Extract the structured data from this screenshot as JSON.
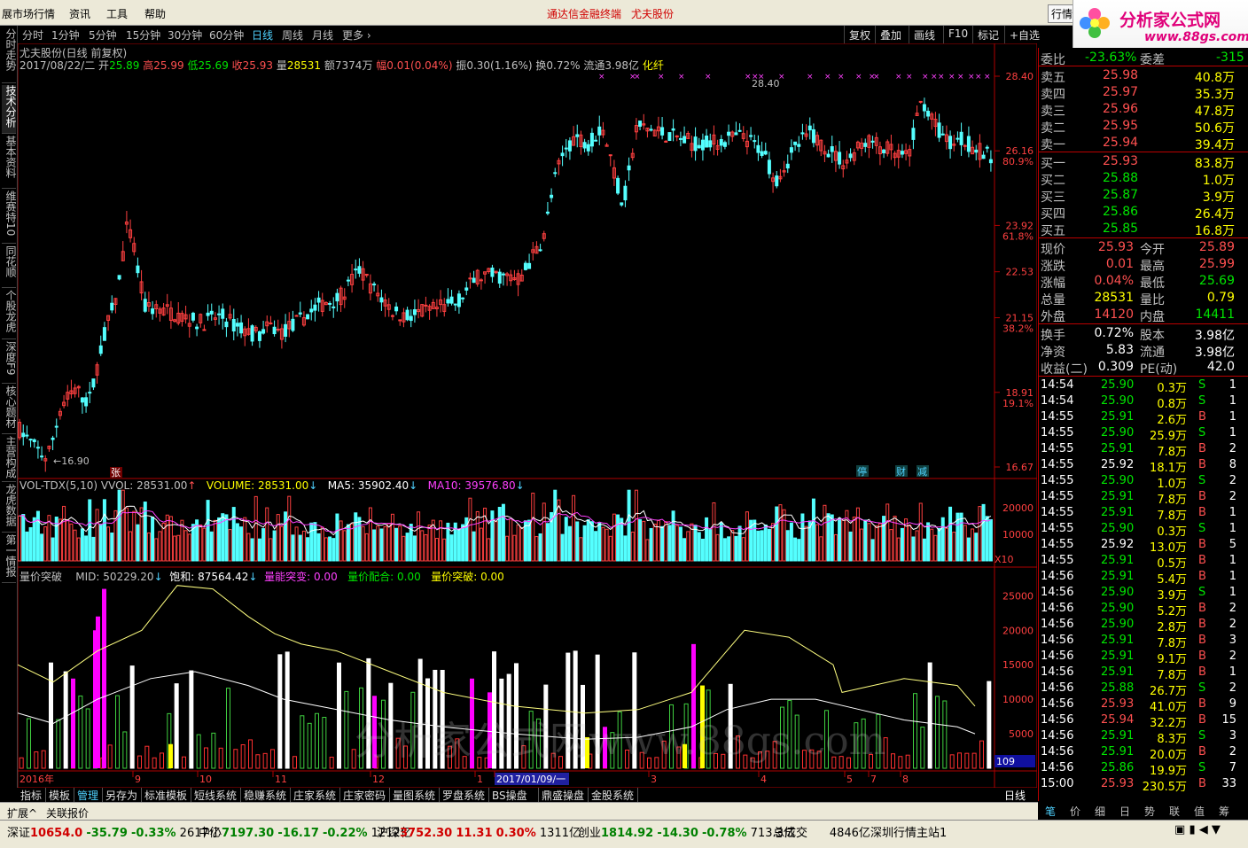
{
  "menu": {
    "market": "展市场行情",
    "news": "资讯",
    "tools": "工具",
    "help": "帮助",
    "center_promo": "通达信金融终端",
    "center_stock": "尤夫股份",
    "right_btn": "行情"
  },
  "logo": {
    "cn": "分析家公式网",
    "url": "www.88gs.com"
  },
  "periods": [
    "分时",
    "1分钟",
    "5分钟",
    "15分钟",
    "30分钟",
    "60分钟",
    "日线",
    "周线",
    "月线",
    "更多 ›"
  ],
  "active_period": "日线",
  "toolbar_right": [
    "复权",
    "叠加",
    "画线",
    "F10",
    "标记",
    "+自选"
  ],
  "left_tabs": [
    "分时走势",
    "技术分析",
    "基本资料",
    "维赛特10",
    "同花顺",
    "个股龙虎",
    "深度F9",
    "核心题材",
    "主营构成",
    "龙虎数据",
    "第一情报"
  ],
  "main": {
    "title": "尤夫股份(日线 前复权)",
    "date": "2017/08/22/二",
    "open_label": "开",
    "open": "25.89",
    "high_label": "高",
    "high": "25.99",
    "low_label": "低",
    "low": "25.69",
    "close_label": "收",
    "close": "25.93",
    "vol_label": "量",
    "vol": "28531",
    "amt_label": "额",
    "amt": "7374万",
    "chg_label": "幅",
    "chg": "0.01(0.04%)",
    "amp": "振0.30(1.16%)",
    "turn": "换0.72%",
    "flow": "流通3.98亿",
    "sector": "化纤",
    "hi_mark": "28.40",
    "lo_mark": "16.90",
    "y_labels": [
      "28.40",
      "26.16",
      "23.92",
      "22.53",
      "21.15",
      "18.91",
      "16.67"
    ],
    "pct_labels": [
      "80.9%",
      "61.8%",
      "38.2%",
      "19.1%"
    ],
    "zhang": "张",
    "events": [
      "停",
      "财",
      "减"
    ]
  },
  "vol_panel": {
    "name": "VOL-TDX(5,10)",
    "vvol_label": "VVOL:",
    "vvol": "28531.00",
    "volume_label": "VOLUME:",
    "volume": "28531.00",
    "ma5_label": "MA5:",
    "ma5": "35902.40",
    "ma10_label": "MA10:",
    "ma10": "39576.80",
    "y_labels": [
      "20000",
      "10000"
    ],
    "x10": "X10"
  },
  "ind_panel": {
    "name": "量价突破",
    "mid_label": "MID:",
    "mid": "50229.20",
    "bh_label": "饱和:",
    "bh": "87564.42",
    "lntp_label": "量能突变:",
    "lntp": "0.00",
    "ljph_label": "量价配合:",
    "ljph": "0.00",
    "ljtp_label": "量价突破:",
    "ljtp": "0.00",
    "y_labels": [
      "25000",
      "20000",
      "15000",
      "10000",
      "5000"
    ],
    "box": "109",
    "watermark": "分析家公式网www.88gs.com"
  },
  "xaxis": {
    "labels": [
      "2016年",
      "9",
      "10",
      "11",
      "12",
      "1",
      "2017/01/09/一",
      "3",
      "4",
      "5",
      "7",
      "8"
    ],
    "period": "日线"
  },
  "bottom_tabs": [
    "指标",
    "模板",
    "管理",
    "另存为",
    "标准模板",
    "短线系统",
    "稳赚系统",
    "庄家系统",
    "庄家密码",
    "量图系统",
    "罗盘系统",
    "BS操盘",
    "鼎盛操盘",
    "金股系统"
  ],
  "active_bottom": "管理",
  "ext": [
    "扩展^",
    "关联报价"
  ],
  "right_tabs": [
    "笔",
    "价",
    "细",
    "日",
    "势",
    "联",
    "值",
    "筹"
  ],
  "quote": {
    "wb_label": "委比",
    "wb": "-23.63%",
    "wc_label": "委差",
    "wc": "-315",
    "asks": [
      [
        "卖五",
        "25.98",
        "40.8万"
      ],
      [
        "卖四",
        "25.97",
        "35.3万"
      ],
      [
        "卖三",
        "25.96",
        "47.8万"
      ],
      [
        "卖二",
        "25.95",
        "50.6万"
      ],
      [
        "卖一",
        "25.94",
        "39.4万"
      ]
    ],
    "bids": [
      [
        "买一",
        "25.93",
        "83.8万"
      ],
      [
        "买二",
        "25.88",
        "1.0万"
      ],
      [
        "买三",
        "25.87",
        "3.9万"
      ],
      [
        "买四",
        "25.86",
        "26.4万"
      ],
      [
        "买五",
        "25.85",
        "16.8万"
      ]
    ],
    "stats": [
      [
        "现价",
        "25.93",
        "今开",
        "25.89"
      ],
      [
        "涨跌",
        "0.01",
        "最高",
        "25.99"
      ],
      [
        "涨幅",
        "0.04%",
        "最低",
        "25.69"
      ],
      [
        "总量",
        "28531",
        "量比",
        "0.79"
      ],
      [
        "外盘",
        "14120",
        "内盘",
        "14411"
      ]
    ],
    "fin": [
      [
        "换手",
        "0.72%",
        "股本",
        "3.98亿"
      ],
      [
        "净资",
        "5.83",
        "流通",
        "3.98亿"
      ],
      [
        "收益(二)",
        "0.309",
        "PE(动)",
        "42.0"
      ]
    ]
  },
  "ticks": [
    [
      "14:54",
      "25.90",
      "0.3万",
      "S",
      "1"
    ],
    [
      "14:54",
      "25.90",
      "0.8万",
      "S",
      "1"
    ],
    [
      "14:55",
      "25.91",
      "2.6万",
      "B",
      "1"
    ],
    [
      "14:55",
      "25.90",
      "25.9万",
      "S",
      "1"
    ],
    [
      "14:55",
      "25.91",
      "7.8万",
      "B",
      "2"
    ],
    [
      "14:55",
      "25.92",
      "18.1万",
      "B",
      "8"
    ],
    [
      "14:55",
      "25.90",
      "1.0万",
      "S",
      "2"
    ],
    [
      "14:55",
      "25.91",
      "7.8万",
      "B",
      "2"
    ],
    [
      "14:55",
      "25.91",
      "7.8万",
      "B",
      "1"
    ],
    [
      "14:55",
      "25.90",
      "0.3万",
      "S",
      "1"
    ],
    [
      "14:55",
      "25.92",
      "13.0万",
      "B",
      "5"
    ],
    [
      "14:55",
      "25.91",
      "0.5万",
      "B",
      "1"
    ],
    [
      "14:56",
      "25.91",
      "5.4万",
      "B",
      "1"
    ],
    [
      "14:56",
      "25.90",
      "3.9万",
      "S",
      "1"
    ],
    [
      "14:56",
      "25.90",
      "5.2万",
      "B",
      "2"
    ],
    [
      "14:56",
      "25.90",
      "2.8万",
      "B",
      "2"
    ],
    [
      "14:56",
      "25.91",
      "7.8万",
      "B",
      "3"
    ],
    [
      "14:56",
      "25.91",
      "9.1万",
      "B",
      "2"
    ],
    [
      "14:56",
      "25.91",
      "7.8万",
      "B",
      "1"
    ],
    [
      "14:56",
      "25.88",
      "26.7万",
      "S",
      "2"
    ],
    [
      "14:56",
      "25.93",
      "41.0万",
      "B",
      "9"
    ],
    [
      "14:56",
      "25.94",
      "32.2万",
      "B",
      "15"
    ],
    [
      "14:56",
      "25.91",
      "8.3万",
      "S",
      "3"
    ],
    [
      "14:56",
      "25.91",
      "20.0万",
      "B",
      "2"
    ],
    [
      "14:56",
      "25.86",
      "19.9万",
      "S",
      "7"
    ],
    [
      "15:00",
      "25.93",
      "230.5万",
      "B",
      "33"
    ]
  ],
  "status": {
    "sz_label": "深证",
    "sz": "10654.0",
    "sz_chg": "-35.79",
    "sz_pct": "-0.33%",
    "sz_amt": "2617亿",
    "zx_label": "中小",
    "zx": "7197.30",
    "zx_chg": "-16.17",
    "zx_pct": "-0.22%",
    "zx_amt": "1212亿",
    "hs_label": "沪深",
    "hs": "3752.30",
    "hs_chg": "11.31",
    "hs_pct": "0.30%",
    "hs_amt": "1311亿",
    "cy_label": "创业",
    "cy": "1814.92",
    "cy_chg": "-14.30",
    "cy_pct": "-0.78%",
    "cy_amt": "713.3亿",
    "total_label": "总成交",
    "total": "4846亿",
    "server": "深圳行情主站1"
  },
  "colors": {
    "up": "#ff4040",
    "down": "#54ffff",
    "frame": "#b00000",
    "ma5": "#ffffff",
    "ma10": "#ff40ff",
    "signal": "#ff00ff"
  }
}
